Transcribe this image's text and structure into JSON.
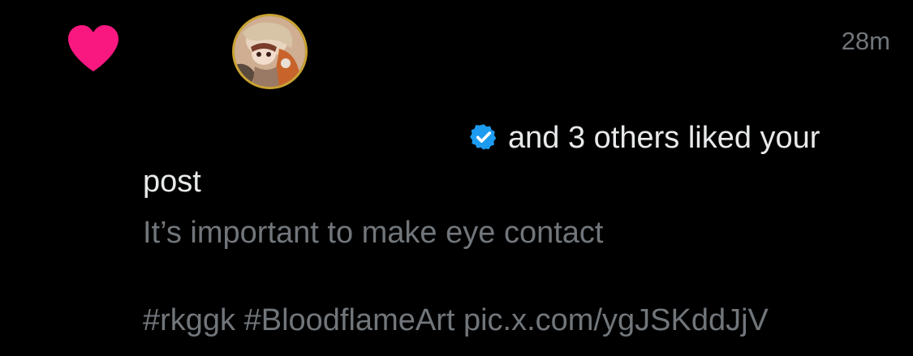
{
  "notification": {
    "icon": "heart-icon",
    "accent_color": "#f91880",
    "verified_color": "#1d9bf0",
    "avatar": "avatar",
    "timestamp": "28m",
    "liked_text": "and 3 others liked your post",
    "post_text": "It’s important to make eye contact",
    "post_tags": "#rkggk #BloodflameArt pic.x.com/ygJSKddJjV"
  }
}
